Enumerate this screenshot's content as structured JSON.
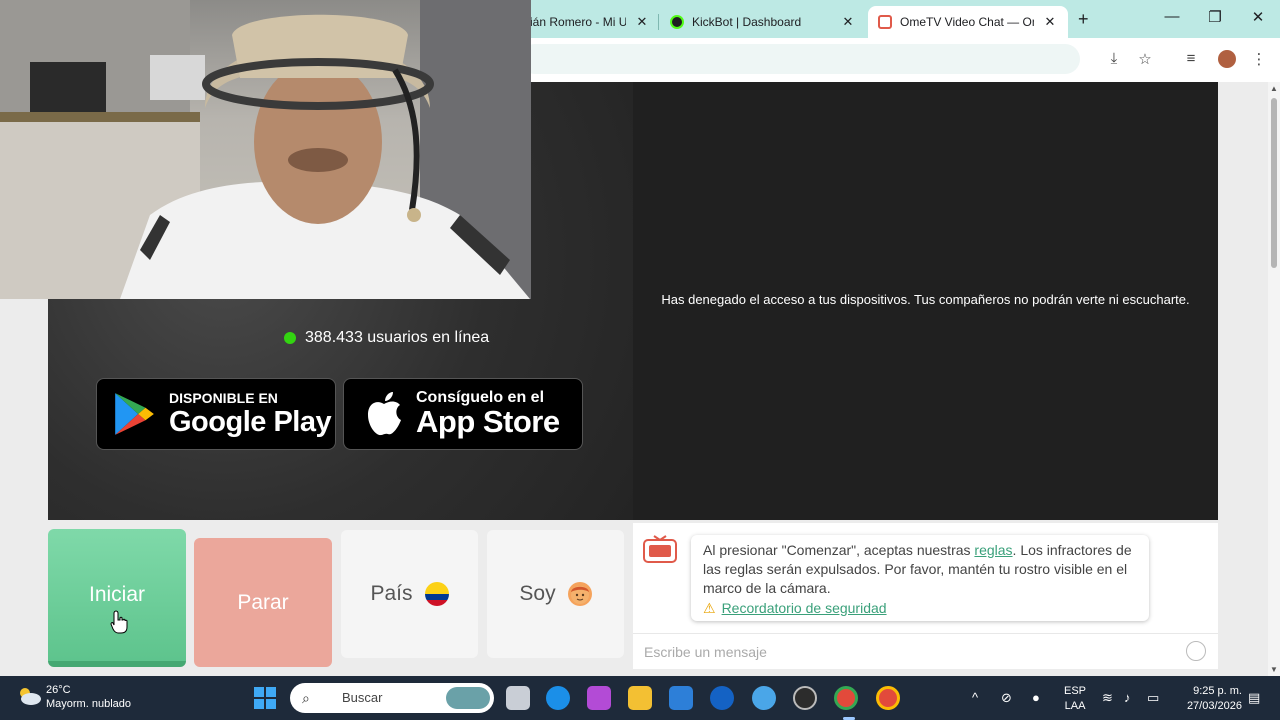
{
  "browser": {
    "tabs": [
      {
        "title": "ián Romero - Mi U",
        "close": "✕"
      },
      {
        "title": "KickBot | Dashboard",
        "close": "✕"
      },
      {
        "title": "OmeTV Video Chat — Ome",
        "close": "✕"
      }
    ],
    "new_tab": "+",
    "win_min": "—",
    "win_max": "❐",
    "win_close": "✕"
  },
  "page": {
    "online_count": "388.433 usuarios en línea",
    "google_play": {
      "sub": "DISPONIBLE EN",
      "main": "Google Play"
    },
    "app_store": {
      "sub": "Consíguelo en el",
      "main": "App Store"
    },
    "denied_message": "Has denegado el acceso a tus dispositivos. Tus compañeros no podrán verte ni escucharte.",
    "buttons": {
      "start": "Iniciar",
      "stop": "Parar",
      "country": "País",
      "gender": "Soy"
    },
    "chat": {
      "rules_pre": "Al presionar \"Comenzar\", aceptas nuestras ",
      "rules_link": "reglas",
      "rules_post": ". Los infractores de las reglas serán expulsados. Por favor, mantén tu rostro visible en el marco de la cámara.",
      "safety_link": "Recordatorio de seguridad",
      "placeholder": "Escribe un mensaje"
    }
  },
  "taskbar": {
    "weather_temp": "26°C",
    "weather_desc": "Mayorm. nublado",
    "search_placeholder": "Buscar",
    "lang_1": "ESP",
    "lang_2": "LAA",
    "time": "9:25 p. m.",
    "date": "27/03/2026"
  }
}
